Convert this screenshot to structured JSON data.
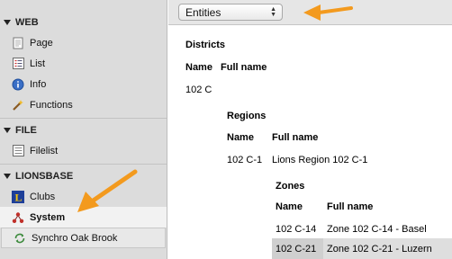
{
  "sidebar": {
    "groups": [
      {
        "title": "WEB",
        "items": [
          {
            "label": "Page",
            "icon": "page-icon"
          },
          {
            "label": "List",
            "icon": "list-icon"
          },
          {
            "label": "Info",
            "icon": "info-icon"
          },
          {
            "label": "Functions",
            "icon": "wand-icon"
          }
        ]
      },
      {
        "title": "FILE",
        "items": [
          {
            "label": "Filelist",
            "icon": "filelist-icon"
          }
        ]
      },
      {
        "title": "LIONSBASE",
        "items": [
          {
            "label": "Clubs",
            "icon": "lions-logo-icon"
          },
          {
            "label": "System",
            "icon": "sitemap-icon"
          },
          {
            "label": "Synchro Oak Brook",
            "icon": "sync-icon"
          }
        ]
      }
    ]
  },
  "toolbar": {
    "select_value": "Entities"
  },
  "content": {
    "districts": {
      "title": "Districts",
      "col_name": "Name",
      "col_full": "Full name",
      "row_name": "102 C",
      "row_full": ""
    },
    "regions": {
      "title": "Regions",
      "col_name": "Name",
      "col_full": "Full name",
      "row_name": "102 C-1",
      "row_full": "Lions Region 102 C-1"
    },
    "zones": {
      "title": "Zones",
      "col_name": "Name",
      "col_full": "Full name",
      "rows": [
        {
          "name": "102 C-14",
          "full": "Zone 102 C-14 - Basel"
        },
        {
          "name": "102 C-21",
          "full": "Zone 102 C-21 - Luzern"
        }
      ]
    }
  },
  "colors": {
    "arrow": "#f39a1e",
    "sidebar_bg": "#dcdcdc",
    "lions_blue": "#1e3f99",
    "lions_yellow": "#f4c40f"
  }
}
